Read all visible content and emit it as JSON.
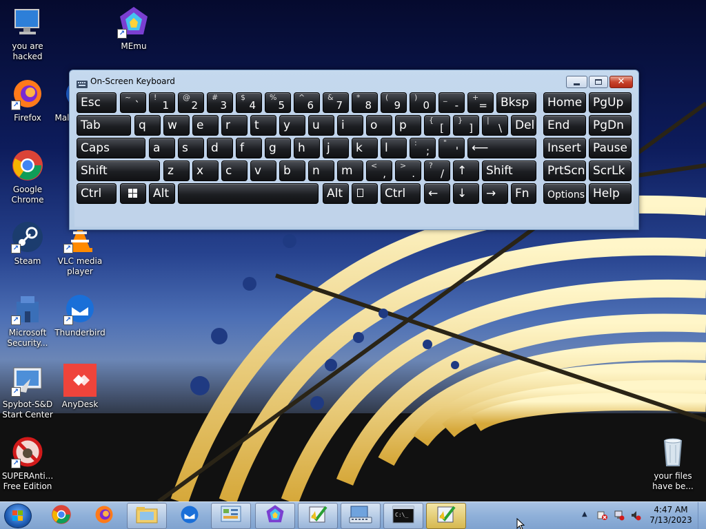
{
  "desktop": {
    "icons": [
      {
        "label": "you are hacked",
        "icon": "computer-icon"
      },
      {
        "label": "MEmu",
        "icon": "memu-icon"
      },
      {
        "label": "Firefox",
        "icon": "firefox-icon"
      },
      {
        "label": "Mal",
        "icon": "malwarebytes-icon"
      },
      {
        "label": "Google Chrome",
        "icon": "chrome-icon"
      },
      {
        "label": "Steam",
        "icon": "steam-icon"
      },
      {
        "label": "VLC media player",
        "icon": "vlc-icon"
      },
      {
        "label": "Microsoft Security...",
        "icon": "security-icon"
      },
      {
        "label": "Thunderbird",
        "icon": "thunderbird-icon"
      },
      {
        "label": "Spybot-S&D Start Center",
        "icon": "spybot-icon"
      },
      {
        "label": "AnyDesk",
        "icon": "anydesk-icon"
      },
      {
        "label": "SUPERAnti... Free Edition",
        "icon": "superantispyware-icon"
      },
      {
        "label": "your files have be...",
        "icon": "recycle-bin-icon"
      }
    ]
  },
  "osk": {
    "title": "On-Screen Keyboard",
    "rows": [
      [
        {
          "main": "Esc"
        },
        {
          "hi": "~",
          "lo": "`"
        },
        {
          "hi": "!",
          "lo": "1"
        },
        {
          "hi": "@",
          "lo": "2"
        },
        {
          "hi": "#",
          "lo": "3"
        },
        {
          "hi": "$",
          "lo": "4"
        },
        {
          "hi": "%",
          "lo": "5"
        },
        {
          "hi": "^",
          "lo": "6"
        },
        {
          "hi": "&",
          "lo": "7"
        },
        {
          "hi": "*",
          "lo": "8"
        },
        {
          "hi": "(",
          "lo": "9"
        },
        {
          "hi": ")",
          "lo": "0"
        },
        {
          "hi": "_",
          "lo": "-"
        },
        {
          "hi": "+",
          "lo": "="
        },
        {
          "main": "Bksp"
        },
        {
          "main": "Home"
        },
        {
          "main": "PgUp"
        }
      ],
      [
        {
          "main": "Tab"
        },
        {
          "main": "q"
        },
        {
          "main": "w"
        },
        {
          "main": "e"
        },
        {
          "main": "r"
        },
        {
          "main": "t"
        },
        {
          "main": "y"
        },
        {
          "main": "u"
        },
        {
          "main": "i"
        },
        {
          "main": "o"
        },
        {
          "main": "p"
        },
        {
          "hi": "{",
          "lo": "["
        },
        {
          "hi": "}",
          "lo": "]"
        },
        {
          "hi": "|",
          "lo": "\\"
        },
        {
          "main": "Del"
        },
        {
          "main": "End"
        },
        {
          "main": "PgDn"
        }
      ],
      [
        {
          "main": "Caps"
        },
        {
          "main": "a"
        },
        {
          "main": "s"
        },
        {
          "main": "d"
        },
        {
          "main": "f"
        },
        {
          "main": "g"
        },
        {
          "main": "h"
        },
        {
          "main": "j"
        },
        {
          "main": "k"
        },
        {
          "main": "l"
        },
        {
          "hi": ":",
          "lo": ";"
        },
        {
          "hi": "\"",
          "lo": "'"
        },
        {
          "main": "⟵"
        },
        {
          "main": "Insert"
        },
        {
          "main": "Pause"
        }
      ],
      [
        {
          "main": "Shift"
        },
        {
          "main": "z"
        },
        {
          "main": "x"
        },
        {
          "main": "c"
        },
        {
          "main": "v"
        },
        {
          "main": "b"
        },
        {
          "main": "n"
        },
        {
          "main": "m"
        },
        {
          "hi": "<",
          "lo": ","
        },
        {
          "hi": ">",
          "lo": "."
        },
        {
          "hi": "?",
          "lo": "/"
        },
        {
          "main": "↑"
        },
        {
          "main": "Shift"
        },
        {
          "main": "PrtScn"
        },
        {
          "main": "ScrLk"
        }
      ],
      [
        {
          "main": "Ctrl"
        },
        {
          "main": "",
          "icon": "windows-logo-icon"
        },
        {
          "main": "Alt"
        },
        {
          "main": ""
        },
        {
          "main": "Alt"
        },
        {
          "main": "",
          "icon": "menu-icon"
        },
        {
          "main": "Ctrl"
        },
        {
          "main": "←"
        },
        {
          "main": "↓"
        },
        {
          "main": "→"
        },
        {
          "main": "Fn"
        },
        {
          "main": "Options"
        },
        {
          "main": "Help"
        }
      ]
    ]
  },
  "taskbar": {
    "items": [
      {
        "name": "chrome",
        "icon": "chrome-icon",
        "state": "pinned"
      },
      {
        "name": "firefox",
        "icon": "firefox-icon",
        "state": "pinned"
      },
      {
        "name": "explorer",
        "icon": "folder-icon",
        "state": "open"
      },
      {
        "name": "thunderbird",
        "icon": "thunderbird-icon",
        "state": "pinned"
      },
      {
        "name": "control-panel",
        "icon": "control-panel-icon",
        "state": "open"
      },
      {
        "name": "memu",
        "icon": "memu-icon",
        "state": "open"
      },
      {
        "name": "notepad-check",
        "icon": "checkmark-doc-icon",
        "state": "open"
      },
      {
        "name": "osk",
        "icon": "keyboard-icon",
        "state": "open"
      },
      {
        "name": "cmd",
        "icon": "cmd-icon",
        "state": "open"
      },
      {
        "name": "notepad-check-2",
        "icon": "checkmark-doc-icon",
        "state": "active"
      }
    ],
    "clock_time": "4:47 AM",
    "clock_date": "7/13/2023"
  },
  "colors": {
    "taskbar": "#8fb0d9",
    "osk_frame": "#c0d3ea",
    "key": "#1c1e22",
    "close_button": "#c8432c"
  }
}
